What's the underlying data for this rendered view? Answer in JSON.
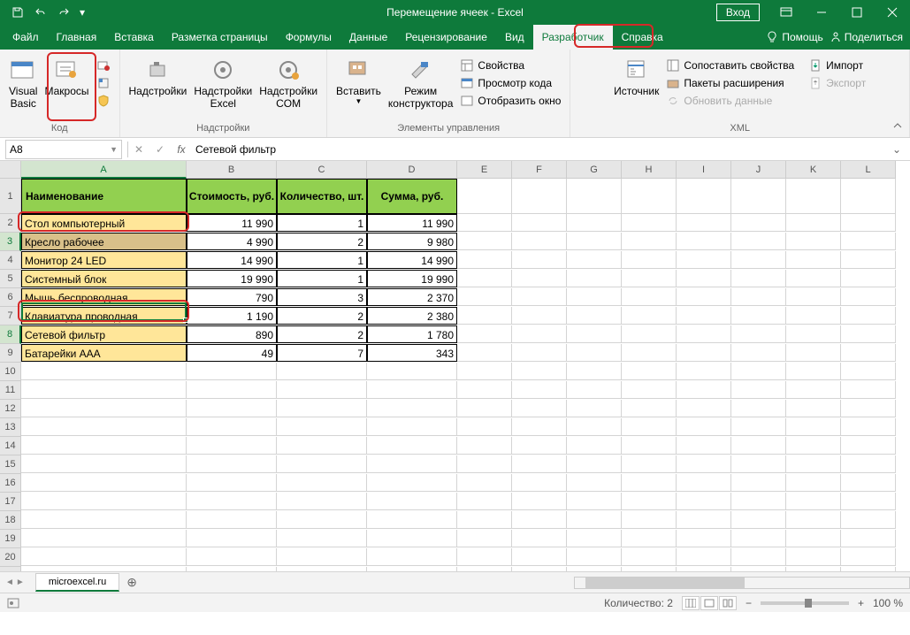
{
  "title": "Перемещение ячеек  -  Excel",
  "signin": "Вход",
  "tabs": [
    "Файл",
    "Главная",
    "Вставка",
    "Разметка страницы",
    "Формулы",
    "Данные",
    "Рецензирование",
    "Вид",
    "Разработчик",
    "Справка"
  ],
  "tabs_active_index": 8,
  "help_btn": "Помощь",
  "share_btn": "Поделиться",
  "ribbon": {
    "code": {
      "vb": "Visual\nBasic",
      "macros": "Макросы",
      "label": "Код"
    },
    "addins": {
      "addins": "Надстройки",
      "excel": "Надстройки\nExcel",
      "com": "Надстройки\nCOM",
      "label": "Надстройки"
    },
    "controls": {
      "insert": "Вставить",
      "design": "Режим\nконструктора",
      "props": "Свойства",
      "view": "Просмотр кода",
      "show": "Отобразить окно",
      "label": "Элементы управления"
    },
    "xml": {
      "source": "Источник",
      "map": "Сопоставить свойства",
      "ext": "Пакеты расширения",
      "refresh": "Обновить данные",
      "import": "Импорт",
      "export": "Экспорт",
      "label": "XML"
    }
  },
  "namebox": "A8",
  "formula": "Сетевой фильтр",
  "cols": [
    "A",
    "B",
    "C",
    "D",
    "E",
    "F",
    "G",
    "H",
    "I",
    "J",
    "K",
    "L"
  ],
  "header_row": [
    "Наименование",
    "Стоимость, руб.",
    "Количество, шт.",
    "Сумма, руб."
  ],
  "rows": [
    {
      "n": "Стол компьютерный",
      "c": "11 990",
      "q": "1",
      "s": "11 990"
    },
    {
      "n": "Кресло рабочее",
      "c": "4 990",
      "q": "2",
      "s": "9 980"
    },
    {
      "n": "Монитор 24 LED",
      "c": "14 990",
      "q": "1",
      "s": "14 990"
    },
    {
      "n": "Системный блок",
      "c": "19 990",
      "q": "1",
      "s": "19 990"
    },
    {
      "n": "Мышь беспроводная",
      "c": "790",
      "q": "3",
      "s": "2 370"
    },
    {
      "n": "Клавиатура проводная",
      "c": "1 190",
      "q": "2",
      "s": "2 380"
    },
    {
      "n": "Сетевой фильтр",
      "c": "890",
      "q": "2",
      "s": "1 780"
    },
    {
      "n": "Батарейки AAA",
      "c": "49",
      "q": "7",
      "s": "343"
    }
  ],
  "sheet_name": "microexcel.ru",
  "status_count": "Количество: 2",
  "zoom": "100 %"
}
